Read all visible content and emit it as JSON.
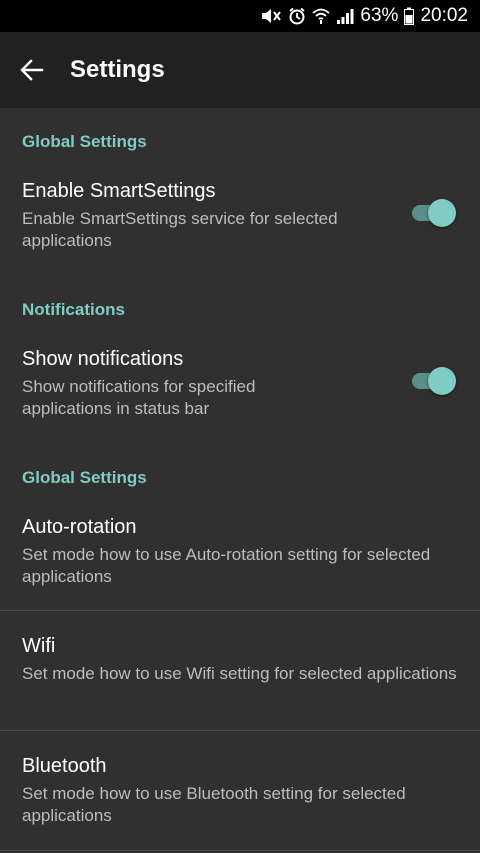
{
  "status_bar": {
    "battery_percent": "63%",
    "time": "20:02"
  },
  "app_bar": {
    "title": "Settings"
  },
  "sections": {
    "global_settings": "Global Settings",
    "notifications": "Notifications",
    "global_settings_2": "Global Settings"
  },
  "settings": {
    "smartsettings": {
      "title": "Enable SmartSettings",
      "summary": "Enable SmartSettings service for selected applications",
      "enabled": true
    },
    "show_notifications": {
      "title": "Show notifications",
      "summary": "Show notifications for specified applications in status bar",
      "enabled": true
    },
    "auto_rotation": {
      "title": "Auto-rotation",
      "summary": "Set mode how to use Auto-rotation setting for selected applications"
    },
    "wifi": {
      "title": "Wifi",
      "summary": "Set mode how to use Wifi setting for selected applications"
    },
    "bluetooth": {
      "title": "Bluetooth",
      "summary": "Set mode how to use Bluetooth setting for selected applications"
    }
  },
  "colors": {
    "accent": "#80cbc4",
    "background": "#303030",
    "app_bar": "#212121"
  }
}
